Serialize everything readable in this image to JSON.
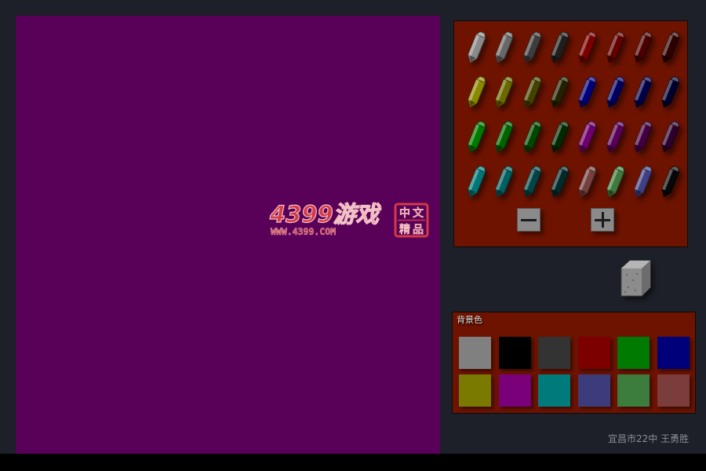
{
  "app": {
    "frame_bg": "#1d2029",
    "panel_bg": "#6e1300"
  },
  "canvas": {
    "background": "#590059"
  },
  "watermark": {
    "logo_text": "4399游戏",
    "url_text": "WWW.4399.COM",
    "seal_text": "中文精品"
  },
  "pens": [
    [
      "#8a8a8a",
      "#686868",
      "#3d3d3d",
      "#1e1e1e",
      "#7a0000",
      "#620000",
      "#4a0000",
      "#2c0000"
    ],
    [
      "#8a8a00",
      "#696900",
      "#434300",
      "#222200",
      "#00007a",
      "#000064",
      "#000048",
      "#00002c"
    ],
    [
      "#007a00",
      "#006400",
      "#004800",
      "#002a00",
      "#6e006e",
      "#580058",
      "#420042",
      "#2c002c"
    ],
    [
      "#007777",
      "#005f5f",
      "#004646",
      "#002b2b",
      "#744040",
      "#3e7a3e",
      "#3f3f84",
      "#070707"
    ]
  ],
  "size_controls": {
    "decrease_icon": "minus-icon",
    "increase_icon": "plus-icon"
  },
  "eraser": {
    "icon": "eraser-icon",
    "color": "#9a9a9a"
  },
  "background_panel": {
    "title": "背景色",
    "swatches": [
      [
        "#808080",
        "#000000",
        "#333333",
        "#7c0000",
        "#007a00",
        "#00007a"
      ],
      [
        "#7a7a00",
        "#7a007a",
        "#007a7a",
        "#3c3c7c",
        "#3c7c3c",
        "#7b3c3c"
      ]
    ]
  },
  "credit": "宜昌市22中  王勇胜"
}
